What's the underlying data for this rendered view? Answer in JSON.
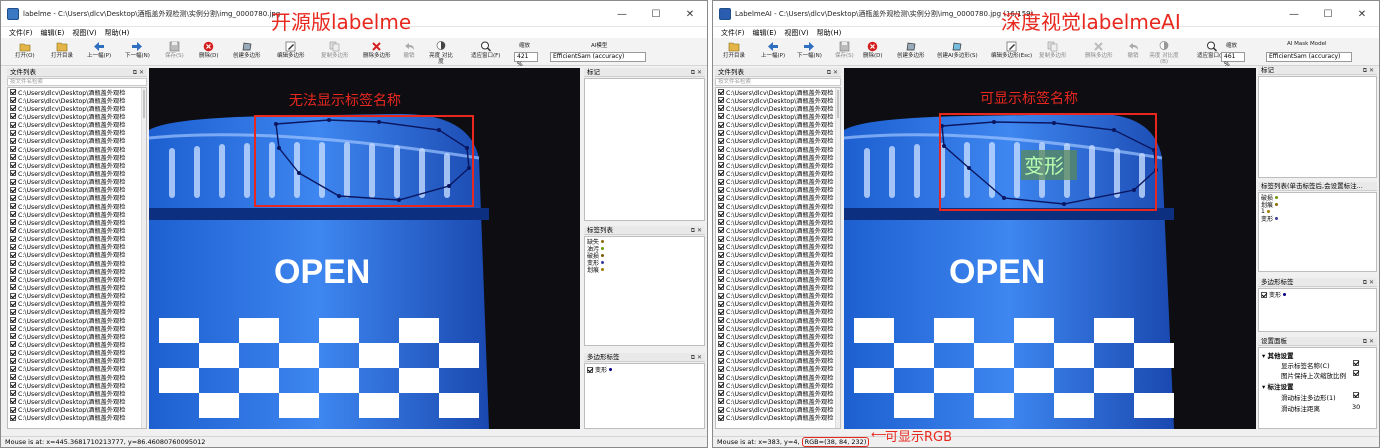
{
  "left": {
    "title": "labelme - C:\\Users\\dlcv\\Desktop\\酒瓶盖外观检测\\实例分割\\img_0000780.jpg",
    "window_buttons": {
      "minimize": "—",
      "maximize": "☐",
      "close": "✕"
    },
    "menu": [
      "文件(F)",
      "编辑(E)",
      "视图(V)",
      "帮助(H)"
    ],
    "toolbar": [
      {
        "label": "打开(O)",
        "icon": "folder-open-icon"
      },
      {
        "label": "打开目录",
        "icon": "folder-icon"
      },
      {
        "label": "上一幅(P)",
        "icon": "arrow-left-icon"
      },
      {
        "label": "下一幅(N)",
        "icon": "arrow-right-icon"
      },
      {
        "label": "保存(S)",
        "icon": "save-icon"
      },
      {
        "label": "删除(D)",
        "icon": "delete-icon"
      },
      {
        "label": "创建多边形",
        "icon": "polygon-icon"
      },
      {
        "label": "编辑多边形",
        "icon": "edit-icon"
      },
      {
        "label": "复制多边形",
        "icon": "copy-icon"
      },
      {
        "label": "删除多边形",
        "icon": "cross-icon"
      },
      {
        "label": "撤销",
        "icon": "undo-icon"
      },
      {
        "label": "亮度 对比度",
        "icon": "brightness-icon"
      },
      {
        "label": "适应窗口(F)",
        "icon": "zoom-icon"
      }
    ],
    "zoom_caption": "缩放",
    "zoom_value": "421 %",
    "ai_caption": "AI模型",
    "ai_value": "EfficientSam (accuracy)",
    "file_list_title": "文件列表",
    "search_placeholder": "按文件名检索",
    "file_row_text": "C:\\Users\\dlcv\\Desktop\\酒瓶盖外观检",
    "flags_title": "标记",
    "label_list_title": "标签列表",
    "labels": [
      {
        "text": "缺失",
        "color": "#8a6a00"
      },
      {
        "text": "油污",
        "color": "#6a9a00"
      },
      {
        "text": "破损",
        "color": "#7a5a00"
      },
      {
        "text": "变形",
        "color": "#3a3aa0"
      },
      {
        "text": "划痕",
        "color": "#a07a00"
      }
    ],
    "polygon_title": "多边形标签",
    "polygon_item": "变形",
    "polygon_color": "#000080",
    "status": "Mouse is at: x=445.3681710213777, y=86.46080760095012",
    "annotation_title": "开源版labelme",
    "annotation_note": "无法显示标签名称",
    "bottle_text": "OPEN"
  },
  "right": {
    "title": "LabelmeAI - C:\\Users\\dlcv\\Desktop\\酒瓶盖外观检测\\实例分割\\img_0000780.jpg (16/159)",
    "window_buttons": {
      "minimize": "—",
      "maximize": "☐",
      "close": "✕"
    },
    "menu": [
      "文件(F)",
      "编辑(E)",
      "视图(V)",
      "帮助(H)"
    ],
    "toolbar": [
      {
        "label": "打开目录",
        "icon": "folder-icon"
      },
      {
        "label": "上一幅(P)",
        "icon": "arrow-left-icon"
      },
      {
        "label": "下一幅(N)",
        "icon": "arrow-right-icon"
      },
      {
        "label": "保存(S)",
        "icon": "save-icon"
      },
      {
        "label": "删除(D)",
        "icon": "delete-icon"
      },
      {
        "label": "创建多边形",
        "icon": "polygon-icon"
      },
      {
        "label": "创建AI多边形(S)",
        "icon": "ai-polygon-icon"
      },
      {
        "label": "编辑多边形(Esc)",
        "icon": "edit-icon"
      },
      {
        "label": "复制多边形",
        "icon": "copy-icon"
      },
      {
        "label": "删除多边形",
        "icon": "cross-icon"
      },
      {
        "label": "撤销",
        "icon": "undo-icon"
      },
      {
        "label": "亮度 对比度(B)",
        "icon": "brightness-icon"
      },
      {
        "label": "适应窗口(F)",
        "icon": "zoom-icon"
      }
    ],
    "zoom_caption": "缩放",
    "zoom_value": "461 %",
    "ai_caption": "AI Mask Model",
    "ai_value": "EfficientSam (accuracy)",
    "file_list_title": "文件列表",
    "search_placeholder": "按文件名检索",
    "file_row_text": "C:\\Users\\dlcv\\Desktop\\酒瓶盖外观检",
    "flags_title": "标记",
    "label_list_title": "标签列表(单击标签后,会设置标注...",
    "labels": [
      {
        "text": "破损",
        "color": "#6a9a00"
      },
      {
        "text": "划痕",
        "color": "#8a6a00"
      },
      {
        "text": "1",
        "color": "#a07a00"
      },
      {
        "text": "变形",
        "color": "#3a3aa0"
      }
    ],
    "polygon_title": "多边形标签",
    "polygon_item": "变形",
    "polygon_color": "#000080",
    "settings_title": "设置面板",
    "settings": {
      "group1": "其他设置",
      "show_label_name": "显示标签名称(C)",
      "keep_zoom": "图片保持上次缩放比例",
      "group2": "标注设置",
      "scroll_poly": "滑动标注多边形(1)",
      "scroll_dist": "滑动标注距离",
      "scroll_dist_value": "30"
    },
    "status_prefix": "Mouse is at: x=383, y=4",
    "status_rgb": "RGB=(38, 84, 232)",
    "annotation_title": "深度视觉labelmeAI",
    "annotation_note": "可显示标签名称",
    "annotation_rgb": "可显示RGB",
    "shape_label": "变形",
    "bottle_text": "OPEN"
  }
}
